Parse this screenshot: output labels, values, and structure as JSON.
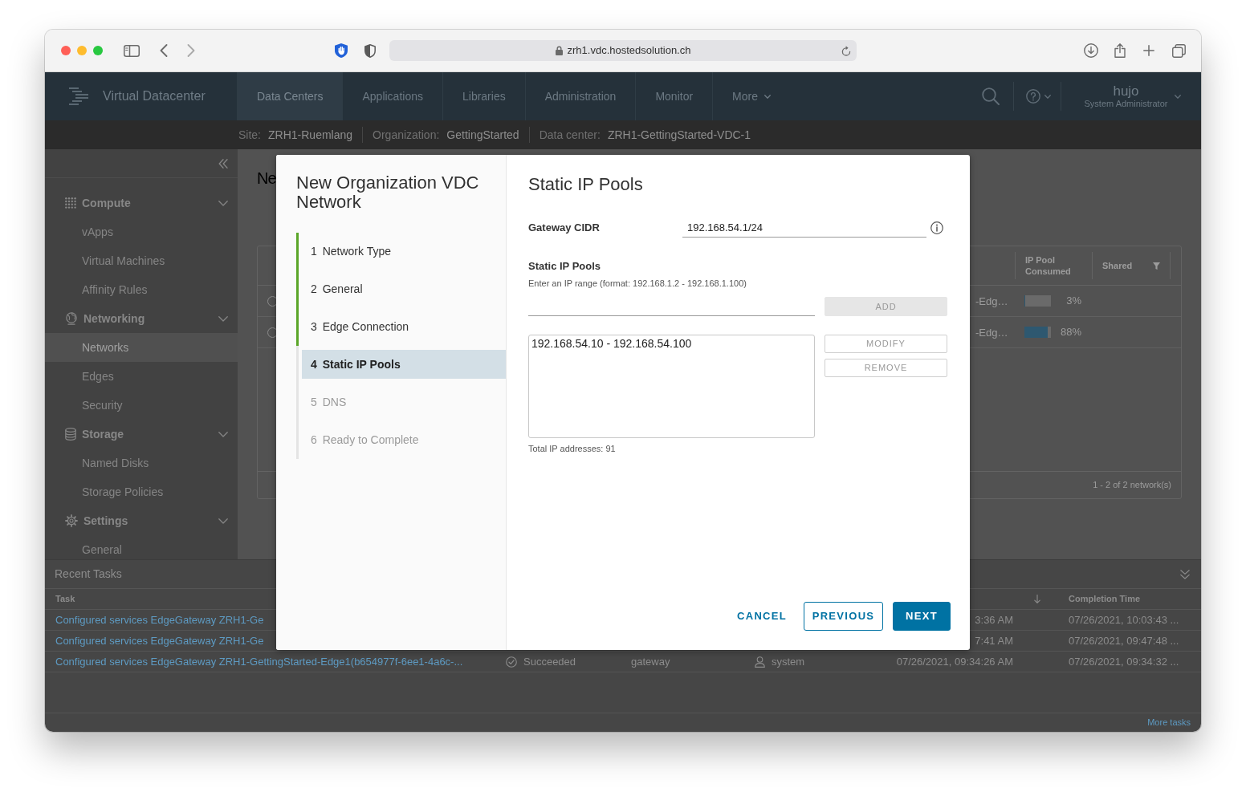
{
  "browser": {
    "url": "zrh1.vdc.hostedsolution.ch"
  },
  "app_header": {
    "title": "Virtual Datacenter",
    "tabs": [
      {
        "label": "Data Centers",
        "selected": true,
        "kind": "link"
      },
      {
        "label": "Applications",
        "selected": false,
        "kind": "link"
      },
      {
        "label": "Libraries",
        "selected": false,
        "kind": "link"
      },
      {
        "label": "Administration",
        "selected": false,
        "kind": "link"
      },
      {
        "label": "Monitor",
        "selected": false,
        "kind": "link"
      },
      {
        "label": "More",
        "selected": false,
        "kind": "menu"
      }
    ],
    "user": {
      "name": "hujo",
      "role": "System Administrator"
    }
  },
  "context_bar": [
    {
      "label": "Site:",
      "value": "ZRH1-Ruemlang"
    },
    {
      "label": "Organization:",
      "value": "GettingStarted"
    },
    {
      "label": "Data center:",
      "value": "ZRH1-GettingStarted-VDC-1"
    }
  ],
  "sidebar": {
    "groups": [
      {
        "label": "Compute",
        "kind": "compute",
        "expanded": true,
        "items": [
          {
            "label": "vApps",
            "selected": false
          },
          {
            "label": "Virtual Machines",
            "selected": false
          },
          {
            "label": "Affinity Rules",
            "selected": false
          }
        ]
      },
      {
        "label": "Networking",
        "kind": "networking",
        "expanded": true,
        "items": [
          {
            "label": "Networks",
            "selected": true
          },
          {
            "label": "Edges",
            "selected": false
          },
          {
            "label": "Security",
            "selected": false
          }
        ]
      },
      {
        "label": "Storage",
        "kind": "storage",
        "expanded": true,
        "items": [
          {
            "label": "Named Disks",
            "selected": false
          },
          {
            "label": "Storage Policies",
            "selected": false
          }
        ]
      },
      {
        "label": "Settings",
        "kind": "settings",
        "expanded": true,
        "items": [
          {
            "label": "General",
            "selected": false
          }
        ]
      }
    ]
  },
  "main": {
    "title": "Ne",
    "table": {
      "columns": [
        {
          "label": "IP Pool Consumed",
          "filter": false
        },
        {
          "label": "Shared",
          "filter": true
        }
      ],
      "rows": [
        {
          "selected": false,
          "column_1": "-Edg…",
          "ip_pool_consumed": {
            "level": 0.03,
            "reading": "3%"
          }
        },
        {
          "selected": false,
          "column_1": "-Edg…",
          "ip_pool_consumed": {
            "level": 0.88,
            "reading": "88%"
          }
        }
      ],
      "footer": "1 - 2 of 2 network(s)"
    }
  },
  "recent_tasks": {
    "title": "Recent Tasks",
    "header": {
      "task": "Task",
      "start_time_sort_descending": true,
      "completion_time": "Completion Time"
    },
    "rows": [
      {
        "task": "Configured services EdgeGateway ZRH1-Ge",
        "start_time": "3:36 AM",
        "completion_time": "07/26/2021, 10:03:43 ..."
      },
      {
        "task": "Configured services EdgeGateway ZRH1-Ge",
        "start_time": "7:41 AM",
        "completion_time": "07/26/2021, 09:47:48 ..."
      },
      {
        "task": "Configured services EdgeGateway ZRH1-GettingStarted-Edge1(b654977f-6ee1-4a6c-...",
        "status": "Succeeded",
        "type": "gateway",
        "initiator": "system",
        "start_time": "07/26/2021, 09:34:26 AM",
        "completion_time": "07/26/2021, 09:34:32 ..."
      }
    ],
    "more_link": "More tasks"
  },
  "dialog": {
    "title": "New Organization VDC Network",
    "steps": [
      {
        "number": "1",
        "label": "Network Type",
        "completed": true,
        "selected": false,
        "disabled": false
      },
      {
        "number": "2",
        "label": "General",
        "completed": true,
        "selected": false,
        "disabled": false
      },
      {
        "number": "3",
        "label": "Edge Connection",
        "completed": true,
        "selected": false,
        "disabled": false
      },
      {
        "number": "4",
        "label": "Static IP Pools",
        "completed": false,
        "selected": true,
        "disabled": false
      },
      {
        "number": "5",
        "label": "DNS",
        "completed": false,
        "selected": false,
        "disabled": true
      },
      {
        "number": "6",
        "label": "Ready to Complete",
        "completed": false,
        "selected": false,
        "disabled": true
      }
    ],
    "page": {
      "title": "Static IP Pools",
      "gateway_cidr": {
        "label": "Gateway CIDR",
        "value": "192.168.54.1/24"
      },
      "static_ip_pools": {
        "title": "Static IP Pools",
        "hint": "Enter an IP range (format: 192.168.1.2 - 192.168.1.100)",
        "add_button": {
          "label": "ADD",
          "disabled": true
        },
        "ranges": [
          {
            "text": "192.168.54.10 - 192.168.54.100",
            "selected": false
          }
        ],
        "modify_button": {
          "label": "MODIFY",
          "disabled": true
        },
        "remove_button": {
          "label": "REMOVE",
          "disabled": true
        },
        "total": "Total IP addresses: 91"
      }
    },
    "buttons": [
      {
        "label": "CANCEL",
        "kind": "cancel"
      },
      {
        "label": "PREVIOUS",
        "kind": "previous"
      },
      {
        "label": "NEXT",
        "kind": "next"
      }
    ]
  }
}
